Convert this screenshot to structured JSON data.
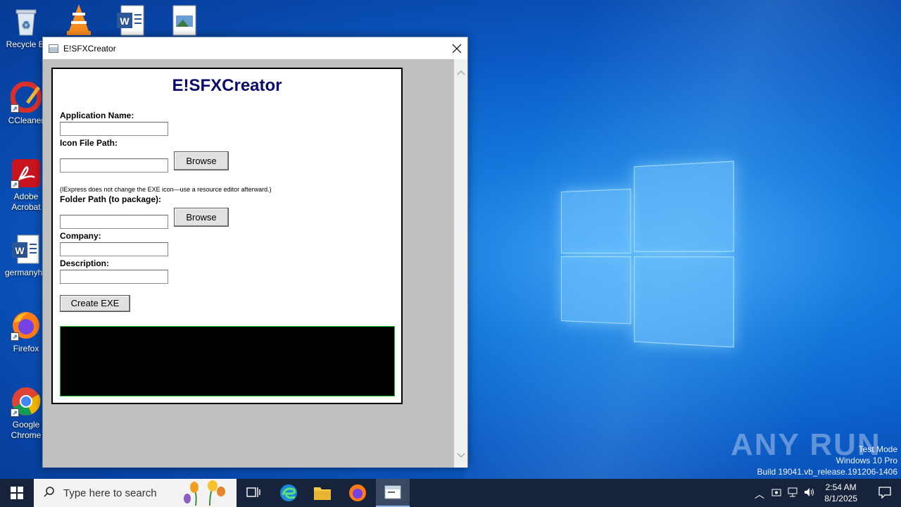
{
  "desktop": {
    "icons": [
      {
        "label": "Recycle Bi",
        "icon": "recycle-bin-icon"
      },
      {
        "label": "CCleaner",
        "icon": "ccleaner-icon"
      },
      {
        "label": "Adobe Acrobat",
        "icon": "adobe-acrobat-icon"
      },
      {
        "label": "germanyho",
        "icon": "word-document-icon"
      },
      {
        "label": "Firefox",
        "icon": "firefox-icon"
      },
      {
        "label": "Google Chrome",
        "icon": "chrome-icon"
      }
    ]
  },
  "window": {
    "title": "E!SFXCreator",
    "heading": "E!SFXCreator",
    "app_name_label": "Application Name:",
    "app_name_value": "",
    "icon_path_label": "Icon File Path:",
    "icon_path_value": "",
    "browse1": "Browse",
    "icon_note": "(IExpress does not change the EXE icon—use a resource editor afterward.)",
    "folder_label": "Folder Path (to package):",
    "folder_value": "",
    "browse2": "Browse",
    "company_label": "Company:",
    "company_value": "",
    "description_label": "Description:",
    "description_value": "",
    "create_button": "Create EXE",
    "output_text": ""
  },
  "watermark": {
    "brand": "ANY RUN",
    "mode": "Test Mode",
    "os": "Windows 10 Pro",
    "build": "Build 19041.vb_release.191206-1406"
  },
  "taskbar": {
    "search_placeholder": "Type here to search",
    "time": "2:54 AM",
    "date": "8/1/2025"
  },
  "colors": {
    "heading": "#0a0a6e",
    "output_border": "#1fbf2a",
    "taskbar": "#16233a"
  }
}
